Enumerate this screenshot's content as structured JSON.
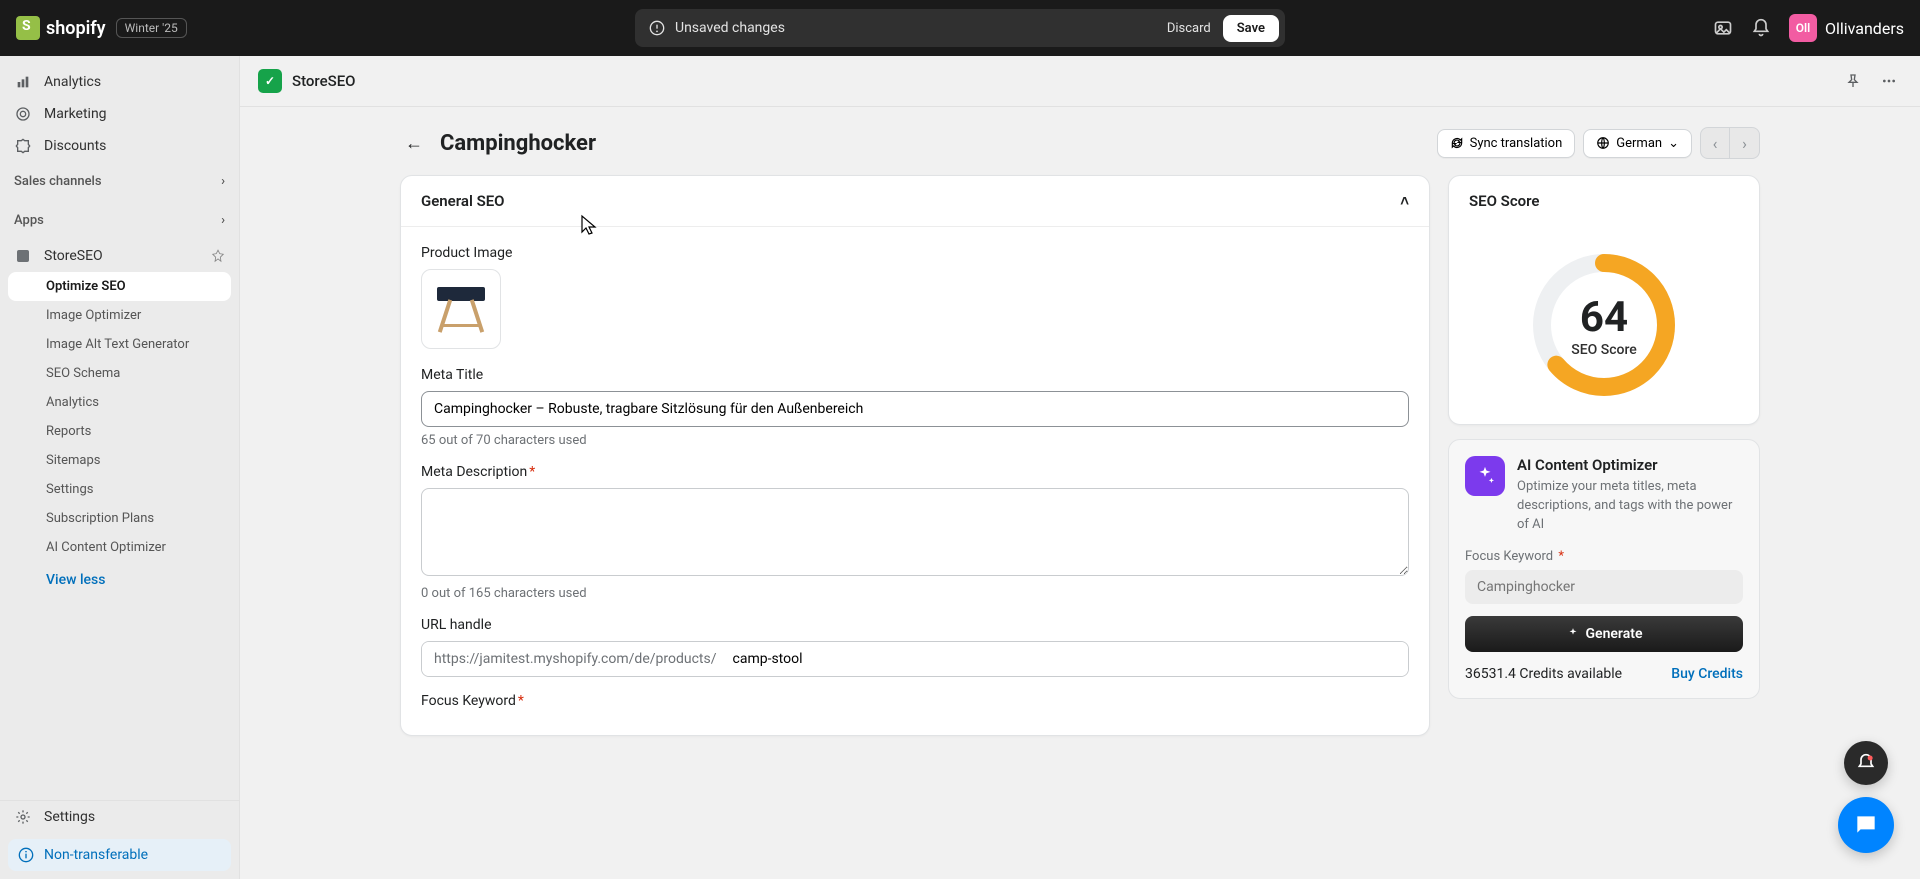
{
  "topbar": {
    "brand": "shopify",
    "version": "Winter '25",
    "unsaved": "Unsaved changes",
    "discard": "Discard",
    "save": "Save",
    "user_initials": "Oll",
    "user_name": "Ollivanders"
  },
  "sidebar": {
    "top": [
      {
        "label": "Analytics"
      },
      {
        "label": "Marketing"
      },
      {
        "label": "Discounts"
      }
    ],
    "sales_channels_label": "Sales channels",
    "apps_label": "Apps",
    "app_item": "StoreSEO",
    "sub_items": [
      "Optimize SEO",
      "Image Optimizer",
      "Image Alt Text Generator",
      "SEO Schema",
      "Analytics",
      "Reports",
      "Sitemaps",
      "Settings",
      "Subscription Plans",
      "AI Content Optimizer"
    ],
    "view_less": "View less",
    "settings": "Settings",
    "nontransferable": "Non-transferable"
  },
  "app_header": {
    "name": "StoreSEO"
  },
  "page": {
    "title": "Campinghocker",
    "sync": "Sync translation",
    "language": "German"
  },
  "general": {
    "heading": "General SEO",
    "product_image_label": "Product Image",
    "meta_title_label": "Meta Title",
    "meta_title_value": "Campinghocker – Robuste, tragbare Sitzlösung für den Außenbereich",
    "meta_title_helper": "65 out of 70 characters used",
    "meta_desc_label": "Meta Description",
    "meta_desc_value": "",
    "meta_desc_helper": "0 out of 165 characters used",
    "url_label": "URL handle",
    "url_prefix": "https://jamitest.myshopify.com/de/products/",
    "url_value": "camp-stool",
    "focus_keyword_label": "Focus Keyword"
  },
  "score": {
    "heading": "SEO Score",
    "value": "64",
    "label": "SEO Score"
  },
  "ai": {
    "title": "AI Content Optimizer",
    "desc": "Optimize your meta titles, meta descriptions, and tags with the power of AI",
    "focus_label": "Focus Keyword",
    "focus_placeholder": "Campinghocker",
    "generate": "Generate",
    "credits": "36531.4 Credits available",
    "buy": "Buy Credits"
  }
}
